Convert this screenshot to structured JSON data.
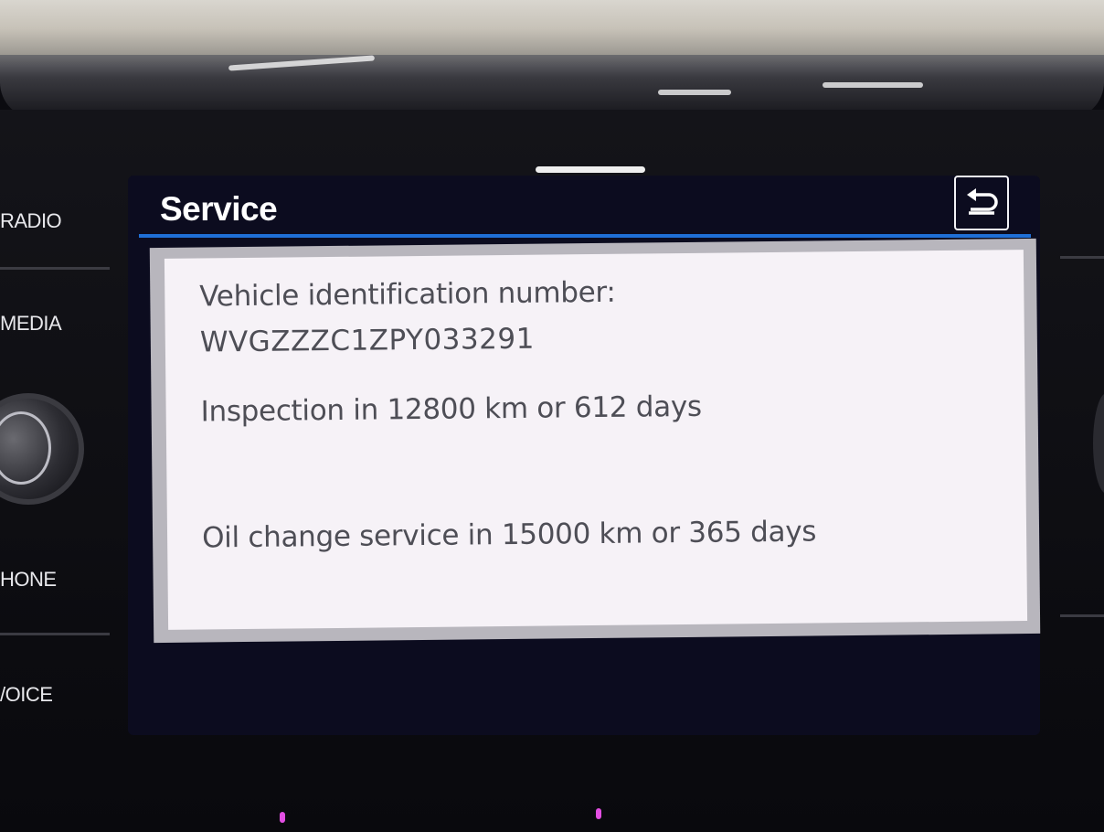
{
  "hard_keys": [
    "RADIO",
    "MEDIA",
    "HONE",
    "/OICE"
  ],
  "screen": {
    "title": "Service",
    "back_icon": "return-arrow-icon"
  },
  "service_info": {
    "vin_label": "Vehicle identification number:",
    "vin_value": "WVGZZZC1ZPY033291",
    "inspection": "Inspection in 12800 km or 612 days",
    "oil_change": "Oil change service in 15000 km or 365 days"
  },
  "colors": {
    "title_bar_accent": "#1f6fd6",
    "panel_background": "#f6f2f7",
    "panel_text": "#4e4e56",
    "display_background": "#0c0c1f",
    "ambient_light": "#e24ee2"
  }
}
